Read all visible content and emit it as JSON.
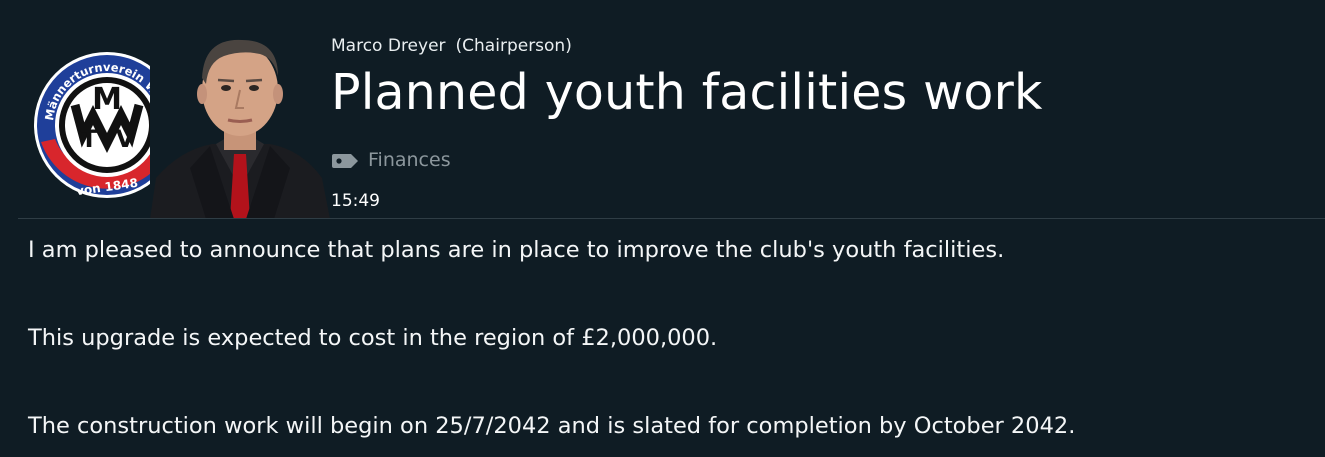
{
  "message": {
    "sender_name": "Marco Dreyer",
    "sender_role": "(Chairperson)",
    "title": "Planned youth facilities work",
    "category": "Finances",
    "time": "15:49",
    "paragraphs": [
      "I am pleased to announce that plans are in place to improve the club's youth facilities.",
      "This upgrade is expected to cost in the region of £2,000,000.",
      "The construction work will begin on 25/7/2042 and is slated for completion by October 2042."
    ]
  },
  "club_crest": {
    "ring_text": "Männerturnverein Wolfenbüttel e.V.",
    "banner_text": "von 1848",
    "monogram": [
      "M",
      "T",
      "V"
    ],
    "colors": {
      "blue": "#1f3f9a",
      "red": "#d8262c",
      "white": "#ffffff",
      "black": "#111111"
    }
  },
  "icons": {
    "category_icon": "tag-icon"
  },
  "colors": {
    "background": "#0f1c24",
    "divider": "#2f3d45",
    "muted_text": "#8c979d"
  }
}
